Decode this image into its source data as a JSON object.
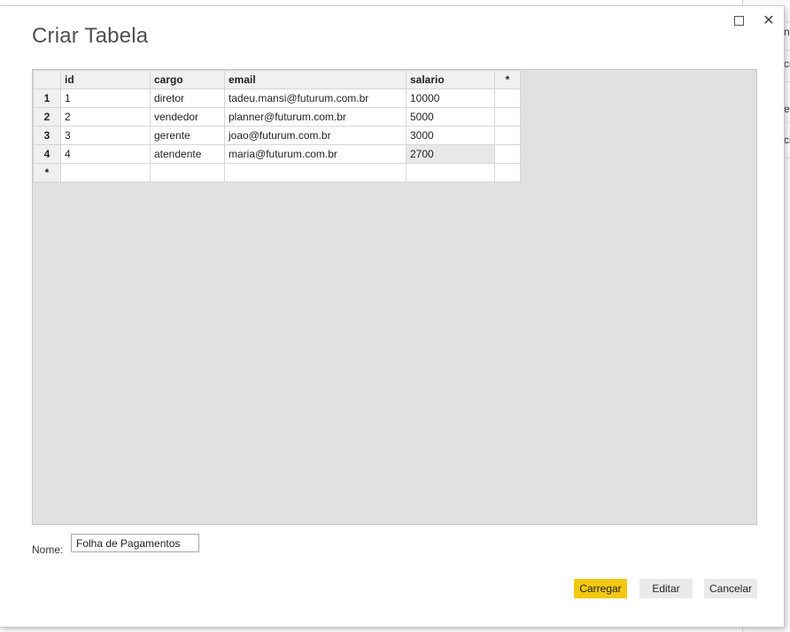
{
  "background_app": {
    "fragments": [
      "n",
      "ci",
      "e",
      "ci"
    ]
  },
  "dialog": {
    "title": "Criar Tabela",
    "window_controls": {
      "maximize_icon": "maximize-icon",
      "close_icon": "close-icon",
      "close_glyph": "✕"
    }
  },
  "table": {
    "corner": "",
    "columns": [
      "id",
      "cargo",
      "email",
      "salario"
    ],
    "add_column_label": "*",
    "rows": [
      {
        "num": "1",
        "cells": [
          "1",
          "diretor",
          "tadeu.mansi@futurum.com.br",
          "10000"
        ]
      },
      {
        "num": "2",
        "cells": [
          "2",
          "vendedor",
          "planner@futurum.com.br",
          "5000"
        ]
      },
      {
        "num": "3",
        "cells": [
          "3",
          "gerente",
          "joao@futurum.com.br",
          "3000"
        ]
      },
      {
        "num": "4",
        "cells": [
          "4",
          "atendente",
          "maria@futurum.com.br",
          "2700"
        ]
      }
    ],
    "new_row_label": "*",
    "selected_cell": {
      "row": 4,
      "column": "salario"
    }
  },
  "name_field": {
    "label": "Nome:",
    "value": "Folha de Pagamentos"
  },
  "buttons": {
    "load": "Carregar",
    "edit": "Editar",
    "cancel": "Cancelar"
  },
  "colors": {
    "accent": "#f2c811",
    "grid_background": "#e1e1e1",
    "header_background": "#f0f0f0"
  }
}
